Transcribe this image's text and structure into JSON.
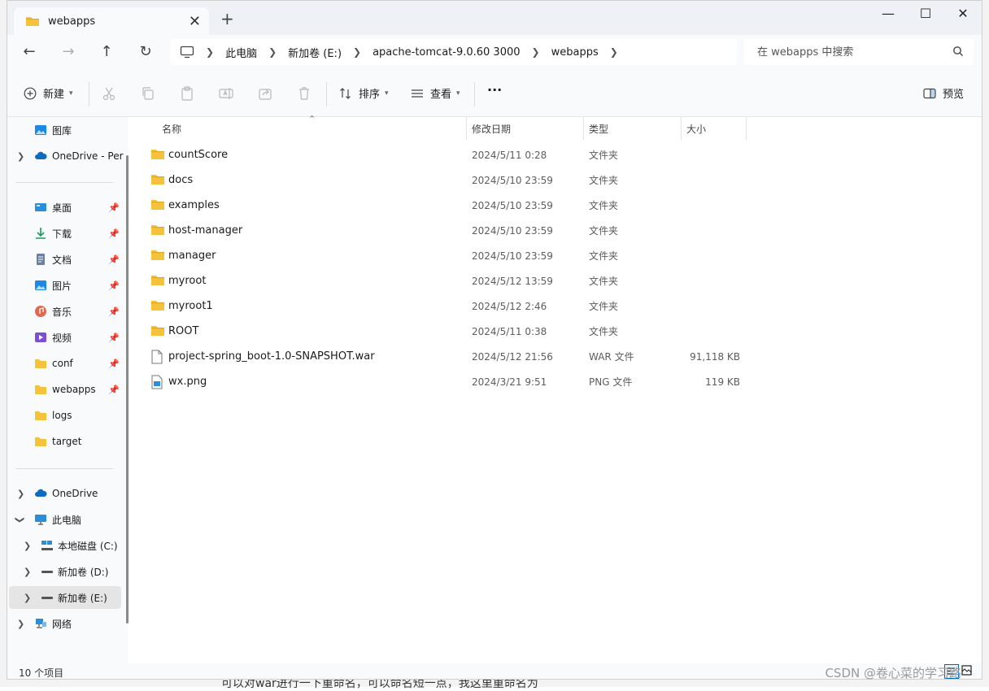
{
  "window": {
    "tab_title": "webapps",
    "new_tab": "+",
    "minimize": "—",
    "maximize": "☐",
    "close": "✕"
  },
  "address": {
    "crumbs": [
      "此电脑",
      "新加卷 (E:)",
      "apache-tomcat-9.0.60 3000",
      "webapps"
    ]
  },
  "search": {
    "placeholder": "在 webapps 中搜索"
  },
  "toolbar": {
    "new_label": "新建",
    "sort_label": "排序",
    "view_label": "查看",
    "more_label": "···",
    "preview_label": "预览"
  },
  "sidebar": {
    "top_items": [
      {
        "label": "图库"
      },
      {
        "label": "OneDrive - Per"
      }
    ],
    "quick_access": [
      {
        "label": "桌面"
      },
      {
        "label": "下载"
      },
      {
        "label": "文档"
      },
      {
        "label": "图片"
      },
      {
        "label": "音乐"
      },
      {
        "label": "视频"
      },
      {
        "label": "conf"
      },
      {
        "label": "webapps"
      },
      {
        "label": "logs"
      },
      {
        "label": "target"
      }
    ],
    "tree": [
      {
        "label": "OneDrive"
      },
      {
        "label": "此电脑"
      },
      {
        "label": "本地磁盘 (C:)"
      },
      {
        "label": "新加卷 (D:)"
      },
      {
        "label": "新加卷 (E:)"
      },
      {
        "label": "网络"
      }
    ]
  },
  "columns": {
    "name": "名称",
    "date": "修改日期",
    "type": "类型",
    "size": "大小"
  },
  "files": [
    {
      "name": "countScore",
      "date": "2024/5/11 0:28",
      "type": "文件夹",
      "size": ""
    },
    {
      "name": "docs",
      "date": "2024/5/10 23:59",
      "type": "文件夹",
      "size": ""
    },
    {
      "name": "examples",
      "date": "2024/5/10 23:59",
      "type": "文件夹",
      "size": ""
    },
    {
      "name": "host-manager",
      "date": "2024/5/10 23:59",
      "type": "文件夹",
      "size": ""
    },
    {
      "name": "manager",
      "date": "2024/5/10 23:59",
      "type": "文件夹",
      "size": ""
    },
    {
      "name": "myroot",
      "date": "2024/5/12 13:59",
      "type": "文件夹",
      "size": ""
    },
    {
      "name": "myroot1",
      "date": "2024/5/12 2:46",
      "type": "文件夹",
      "size": ""
    },
    {
      "name": "ROOT",
      "date": "2024/5/11 0:38",
      "type": "文件夹",
      "size": ""
    },
    {
      "name": "project-spring_boot-1.0-SNAPSHOT.war",
      "date": "2024/5/12 21:56",
      "type": "WAR 文件",
      "size": "91,118 KB"
    },
    {
      "name": "wx.png",
      "date": "2024/3/21 9:51",
      "type": "PNG 文件",
      "size": "119 KB"
    }
  ],
  "status": {
    "item_count": "10 个项目"
  },
  "background": {
    "caption": "可以对war进行一下重命名，可以命名短一点，我这里重命名为",
    "watermark": "CSDN @卷心菜的学习路"
  },
  "colors": {
    "folder": "#f5c33b",
    "folder_dark": "#e0a820",
    "accent": "#0067c0"
  }
}
